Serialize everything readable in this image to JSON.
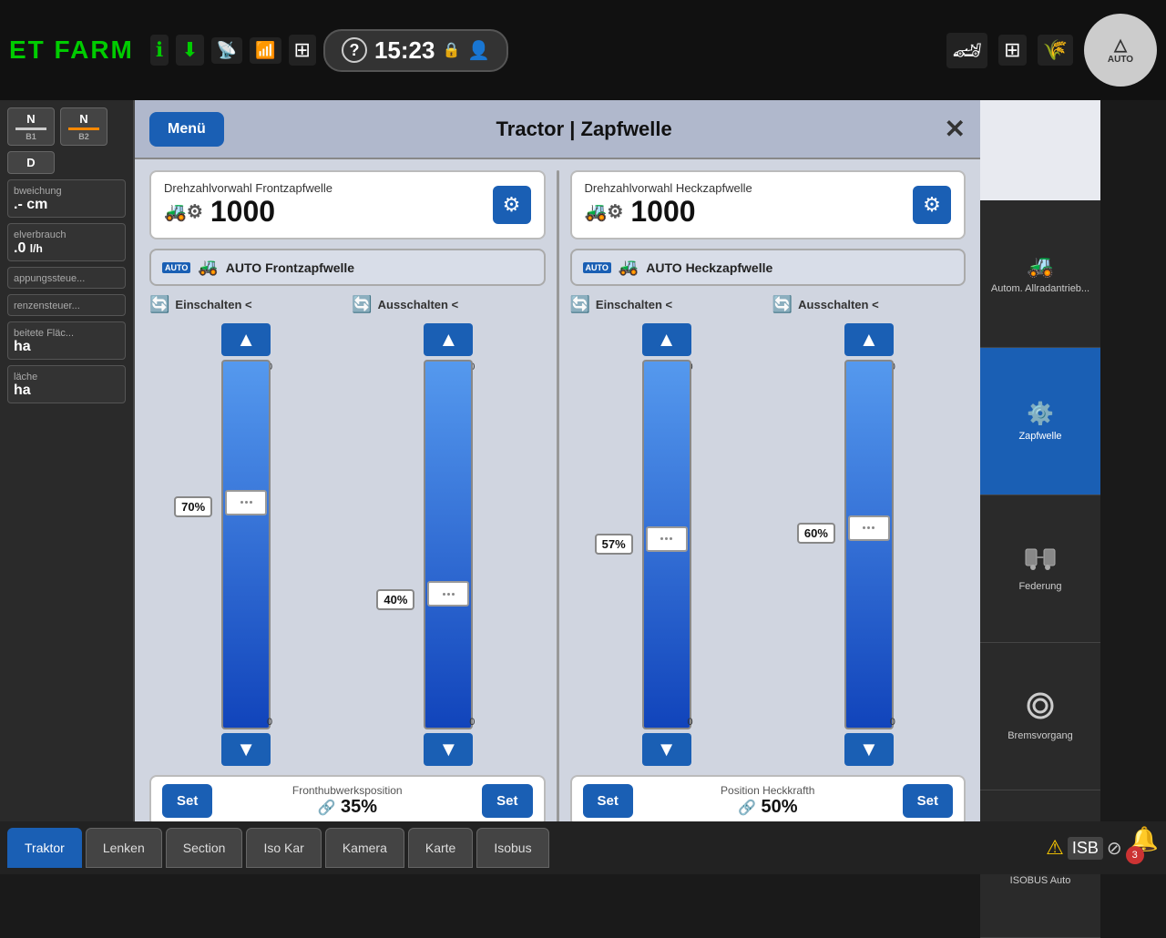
{
  "app": {
    "logo": "ET FARM",
    "clock": "15:23",
    "auto_label": "AUTO"
  },
  "header": {
    "title": "Tractor | Zapfwelle",
    "menu_btn": "Menü",
    "close": "✕"
  },
  "front_pto": {
    "rpm_label": "Drehzahlvorwahl Frontzapfwelle",
    "rpm_value": "1000",
    "auto_label": "AUTO Frontzapfwelle",
    "on_label": "Einschalten <",
    "off_label": "Ausschalten <",
    "slider1_pct": "70%",
    "slider1_max": "100",
    "slider1_min": "0",
    "slider2_pct": "40%",
    "slider2_max": "100",
    "slider2_min": "0",
    "position_label": "Fronthubwerksposition",
    "position_value": "35%",
    "set_label": "Set"
  },
  "rear_pto": {
    "rpm_label": "Drehzahlvorwahl Heckzapfwelle",
    "rpm_value": "1000",
    "auto_label": "AUTO Heckzapfwelle",
    "on_label": "Einschalten <",
    "off_label": "Ausschalten <",
    "slider1_pct": "57%",
    "slider1_max": "100",
    "slider1_min": "0",
    "slider2_pct": "60%",
    "slider2_max": "100",
    "slider2_min": "0",
    "position_label": "Position Heckkrafth",
    "position_value": "50%",
    "set_label": "Set"
  },
  "right_sidebar": {
    "items": [
      {
        "id": "allrad",
        "label": "Autom. Allradantrieb...",
        "icon": "🚜"
      },
      {
        "id": "zapfwelle",
        "label": "Zapfwelle",
        "icon": "⚙️",
        "active": true
      },
      {
        "id": "federung",
        "label": "Federung",
        "icon": "🚗"
      },
      {
        "id": "bremsvorgang",
        "label": "Bremsvorgang",
        "icon": "⭕"
      },
      {
        "id": "isobus",
        "label": "ISOBUS Auto",
        "icon": "ISB"
      }
    ]
  },
  "left_sidebar": {
    "b1": "N",
    "b2": "N",
    "d_label": "D",
    "abweichung_label": "bweichung",
    "abweichung_value": ".- cm",
    "verbrauch_label": "elverbrauch",
    "verbrauch_value": ".0",
    "verbrauch_unit": "l/h",
    "kupplung_label": "appungssteue...",
    "grenzen_label": "renzensteuer...",
    "flaeche_label": "beitete Fläc...",
    "flaeche_value": "ha",
    "flaeche2_label": "läche",
    "flaeche2_value": "ha"
  },
  "bottom_tabs": {
    "items": [
      {
        "id": "traktor",
        "label": "Traktor",
        "active": true
      },
      {
        "id": "lenken",
        "label": "Lenken"
      },
      {
        "id": "section",
        "label": "Section"
      },
      {
        "id": "isokar",
        "label": "Iso Kar"
      },
      {
        "id": "kamera",
        "label": "Kamera"
      },
      {
        "id": "karte",
        "label": "Karte"
      },
      {
        "id": "isobus",
        "label": "Isobus"
      }
    ],
    "notification_count": "3"
  }
}
